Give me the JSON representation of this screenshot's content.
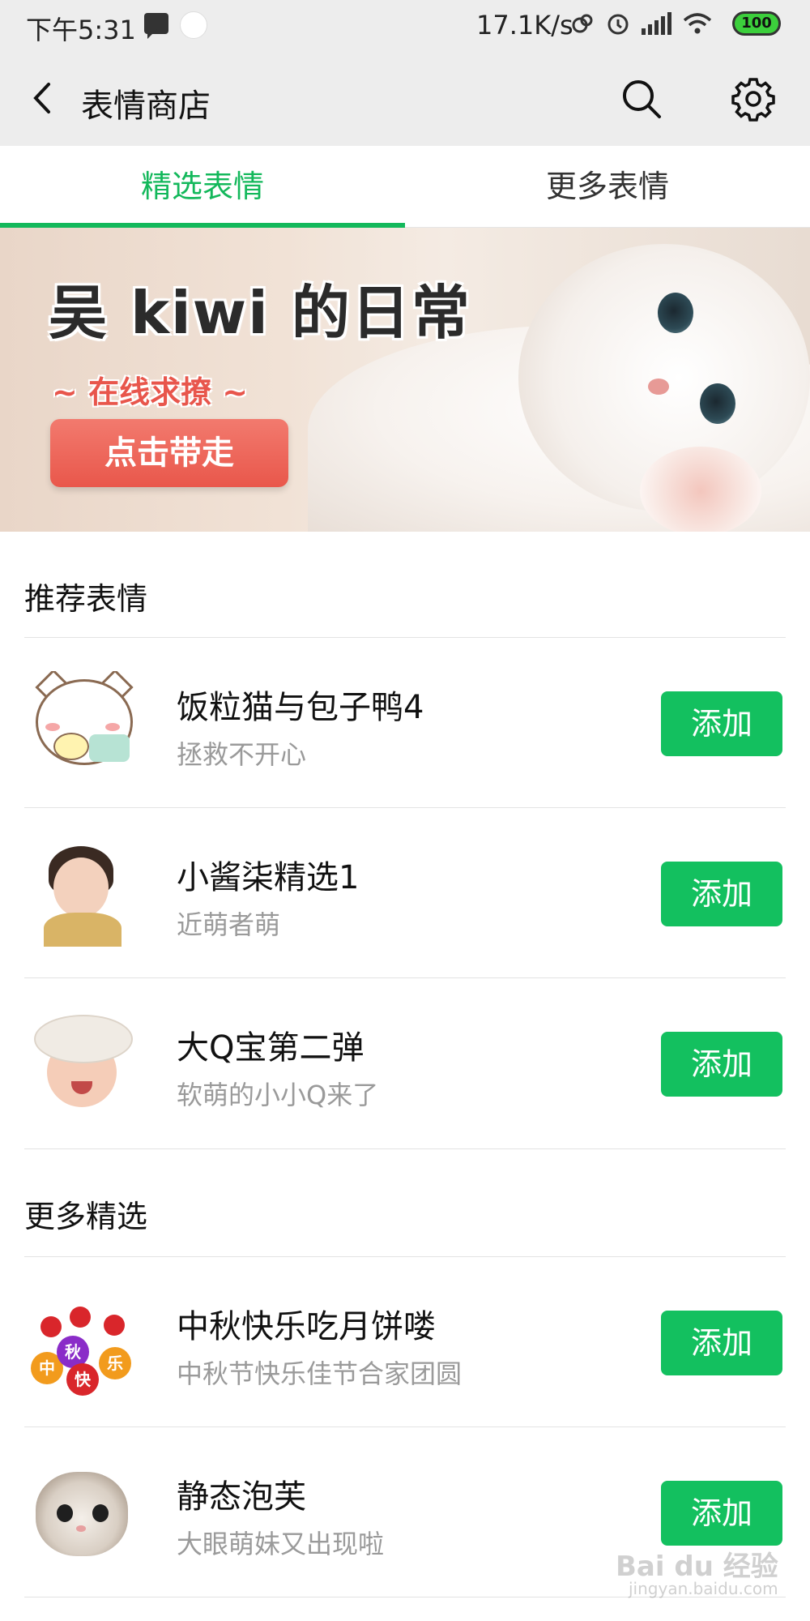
{
  "status_bar": {
    "time": "下午5:31",
    "speed": "17.1K/s",
    "battery": "100"
  },
  "header": {
    "title": "表情商店"
  },
  "tabs": [
    {
      "label": "精选表情"
    },
    {
      "label": "更多表情"
    }
  ],
  "banner": {
    "title": "吴 kiwi 的日常",
    "subtitle": "~ 在线求撩 ~",
    "button": "点击带走"
  },
  "sections": [
    {
      "title": "推荐表情",
      "items": [
        {
          "name": "饭粒猫与包子鸭4",
          "desc": "拯救不开心",
          "button": "添加"
        },
        {
          "name": "小酱柒精选1",
          "desc": "近萌者萌",
          "button": "添加"
        },
        {
          "name": "大Q宝第二弹",
          "desc": "软萌的小小Q来了",
          "button": "添加"
        }
      ]
    },
    {
      "title": "更多精选",
      "items": [
        {
          "name": "中秋快乐吃月饼喽",
          "desc": "中秋节快乐佳节合家团圆",
          "button": "添加"
        },
        {
          "name": "静态泡芙",
          "desc": "大眼萌妹又出现啦",
          "button": "添加"
        }
      ]
    }
  ],
  "thumb_text": {
    "zhong": "中",
    "qiu": "秋",
    "kuai": "快",
    "le": "乐"
  },
  "watermark": {
    "logo": "Bai du 经验",
    "url": "jingyan.baidu.com"
  },
  "colors": {
    "accent": "#13c05f",
    "tab_active": "#13b85b",
    "header_bg": "#ededed"
  }
}
